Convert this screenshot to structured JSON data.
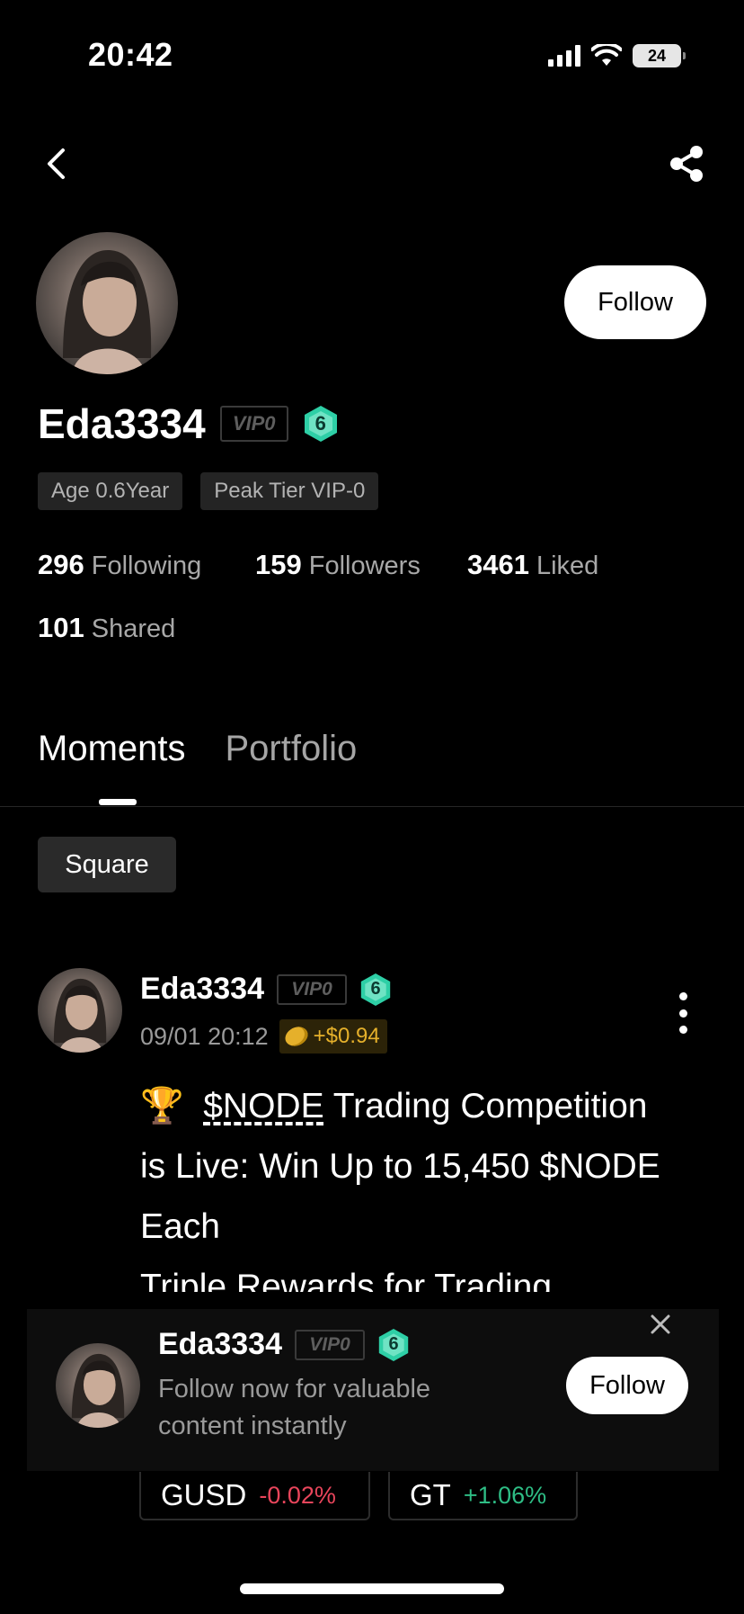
{
  "status_bar": {
    "time": "20:42",
    "battery": "24",
    "icons": [
      "signal-icon",
      "wifi-icon",
      "battery-icon"
    ]
  },
  "nav": {
    "back_icon": "chevron-left-icon",
    "share_icon": "share-icon"
  },
  "profile": {
    "username": "Eda3334",
    "vip_badge": "VIP0",
    "level": "6",
    "follow_label": "Follow",
    "tags": [
      "Age 0.6Year",
      "Peak Tier VIP-0"
    ],
    "stats": {
      "following": {
        "value": "296",
        "label": "Following"
      },
      "followers": {
        "value": "159",
        "label": "Followers"
      },
      "liked": {
        "value": "3461",
        "label": "Liked"
      },
      "shared": {
        "value": "101",
        "label": "Shared"
      }
    }
  },
  "tabs": [
    {
      "label": "Moments",
      "active": true
    },
    {
      "label": "Portfolio",
      "active": false
    }
  ],
  "filter": {
    "label": "Square"
  },
  "post": {
    "username": "Eda3334",
    "vip_badge": "VIP0",
    "level": "6",
    "time": "09/01 20:12",
    "reward": "+$0.94",
    "trophy": "🏆",
    "ticker": "$NODE",
    "text_line1_rest": " Trading Competition",
    "text_line2": "is Live: Win Up to 15,450 $NODE",
    "text_line3": "Each",
    "text_line4": "Triple Rewards for Trading"
  },
  "popup": {
    "username": "Eda3334",
    "vip_badge": "VIP0",
    "level": "6",
    "message": "Follow now for valuable content instantly",
    "follow_label": "Follow"
  },
  "tokens": [
    {
      "symbol": "GUSD",
      "change": "-0.02%"
    },
    {
      "symbol": "GT",
      "change": "+1.06%"
    }
  ],
  "colors": {
    "background": "#000000",
    "negative": "#e8455b",
    "positive": "#2ebd85",
    "level_badge": "#2ecfa6",
    "reward": "#e5b02b"
  }
}
